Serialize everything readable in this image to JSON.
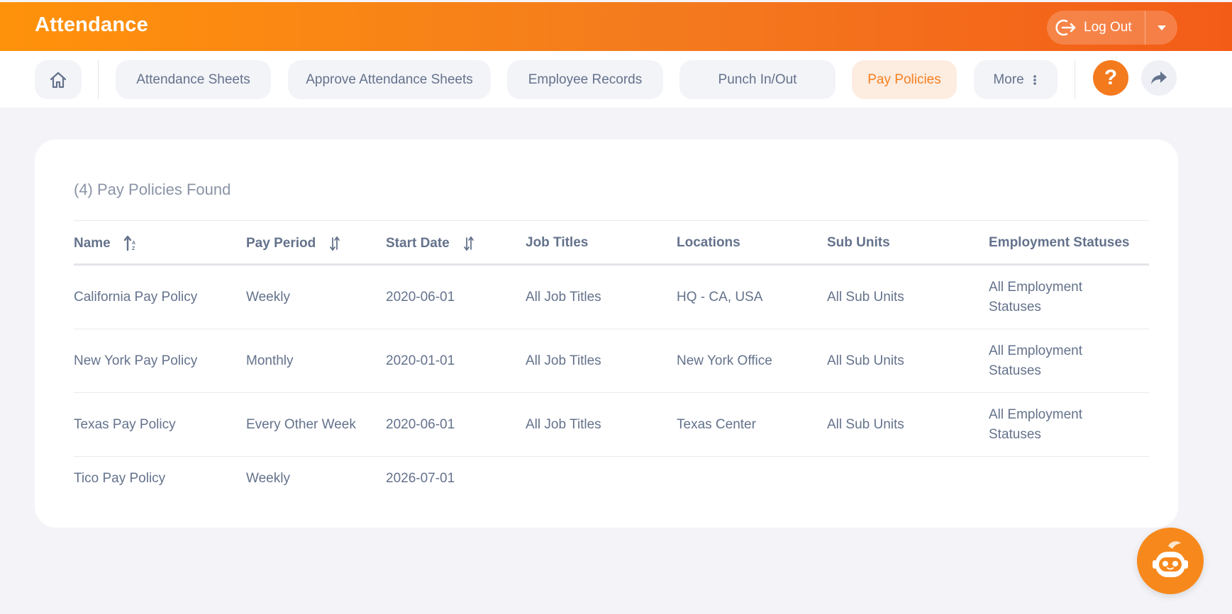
{
  "header": {
    "title": "Attendance",
    "logout_label": "Log Out"
  },
  "nav": {
    "items": [
      {
        "label": "Attendance Sheets"
      },
      {
        "label": "Approve Attendance Sheets"
      },
      {
        "label": "Employee Records"
      },
      {
        "label": "Punch In/Out"
      },
      {
        "label": "Pay Policies",
        "active": true
      },
      {
        "label": "More"
      }
    ],
    "help_label": "?"
  },
  "main": {
    "found_text": "(4) Pay Policies Found",
    "columns": [
      "Name",
      "Pay Period",
      "Start Date",
      "Job Titles",
      "Locations",
      "Sub Units",
      "Employment Statuses"
    ],
    "rows": [
      [
        "California Pay Policy",
        "Weekly",
        "2020-06-01",
        "All Job Titles",
        "HQ - CA, USA",
        "All Sub Units",
        "All Employment Statuses"
      ],
      [
        "New York Pay Policy",
        "Monthly",
        "2020-01-01",
        "All Job Titles",
        "New York Office",
        "All Sub Units",
        "All Employment Statuses"
      ],
      [
        "Texas Pay Policy",
        "Every Other Week",
        "2020-06-01",
        "All Job Titles",
        "Texas Center",
        "All Sub Units",
        "All Employment Statuses"
      ],
      [
        "Tico Pay Policy",
        "Weekly",
        "2026-07-01",
        "",
        "",
        "",
        ""
      ]
    ]
  },
  "colors": {
    "accent": "#f47a1e",
    "header_start": "#ff920b",
    "header_end": "#f35c17",
    "text": "#64728c",
    "active_bg": "#fdece0"
  },
  "icons": [
    "home-icon",
    "logout-icon",
    "caret-down-icon",
    "more-dots-icon",
    "help-icon",
    "share-icon",
    "sort-asc-icon",
    "sort-icon",
    "chatbot-icon"
  ]
}
